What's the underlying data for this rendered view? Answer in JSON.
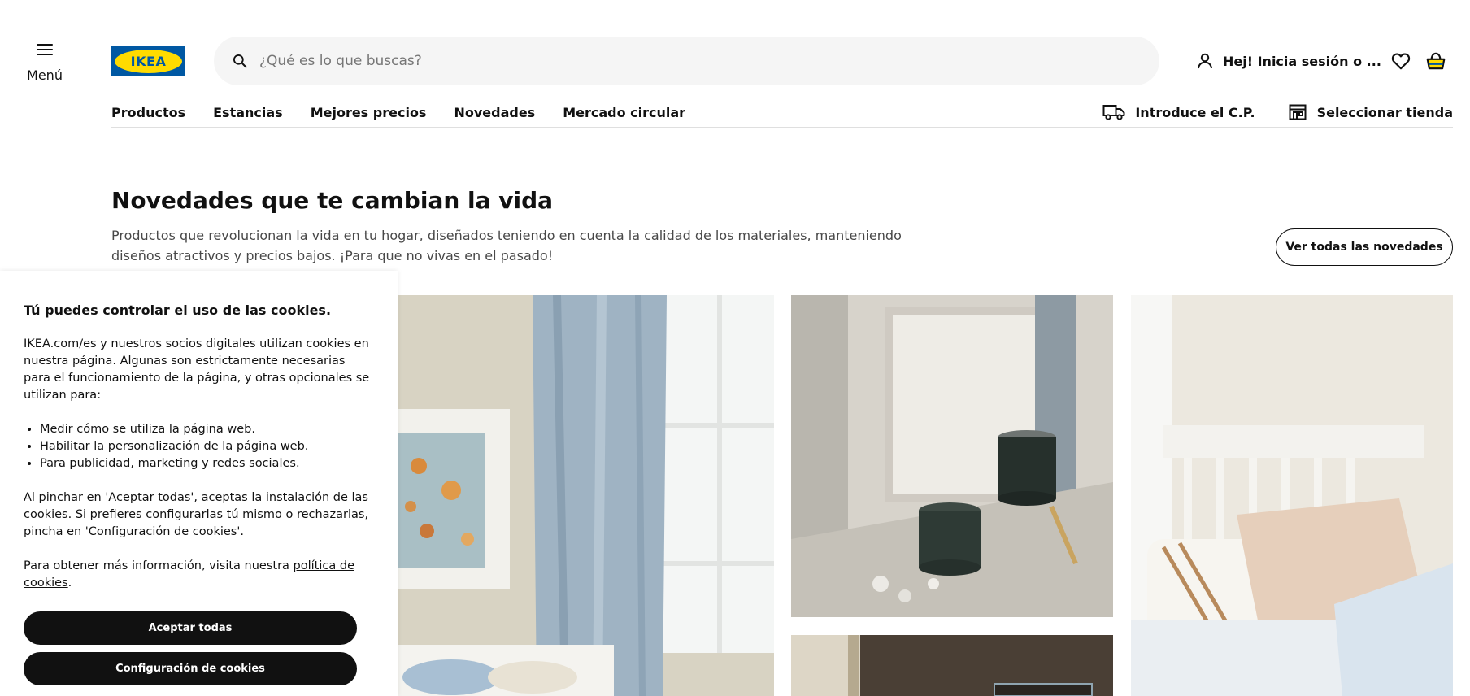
{
  "header": {
    "menu_label": "Menú",
    "logo_text": "IKEA",
    "search_placeholder": "¿Qué es lo que buscas?",
    "account_label": "Hej! Inicia sesión o ...",
    "brand_colors": {
      "blue": "#0058a3",
      "yellow": "#ffdb00"
    }
  },
  "nav": {
    "items": [
      "Productos",
      "Estancias",
      "Mejores precios",
      "Novedades",
      "Mercado circular"
    ],
    "postal_code_label": "Introduce el C.P.",
    "store_label": "Seleccionar tienda"
  },
  "icons": {
    "menu": "hamburger-icon",
    "search": "search-icon",
    "account": "user-icon",
    "wishlist": "heart-icon",
    "cart": "shopping-bag-icon",
    "delivery": "truck-icon",
    "store": "store-icon"
  },
  "section": {
    "title": "Novedades que te cambian la vida",
    "description": "Productos que revolucionan la vida en tu hogar, diseñados teniendo en cuenta la calidad de los materiales, manteniendo diseños atractivos y precios bajos. ¡Para que no vivas en el pasado!",
    "see_all_label": "Ver todas las novedades"
  },
  "cookie_banner": {
    "title": "Tú puedes controlar el uso de las cookies.",
    "intro": "IKEA.com/es y nuestros socios digitales utilizan cookies en nuestra página. Algunas son estrictamente necesarias para el funcionamiento de la página, y otras opcionales se utilizan para:",
    "purposes": [
      "Medir cómo se utiliza la página web.",
      "Habilitar la personalización de la página web.",
      "Para publicidad, marketing y redes sociales."
    ],
    "accept_info": "Al pinchar en 'Aceptar todas', aceptas la instalación de las cookies. Si prefieres configurarlas tú mismo o rechazarlas, pincha en 'Configuración de cookies'.",
    "more_info_prefix": "Para obtener más información, visita nuestra ",
    "policy_link": "política de cookies",
    "more_info_suffix": ".",
    "accept_button": "Aceptar todas",
    "settings_button": "Configuración de cookies"
  }
}
